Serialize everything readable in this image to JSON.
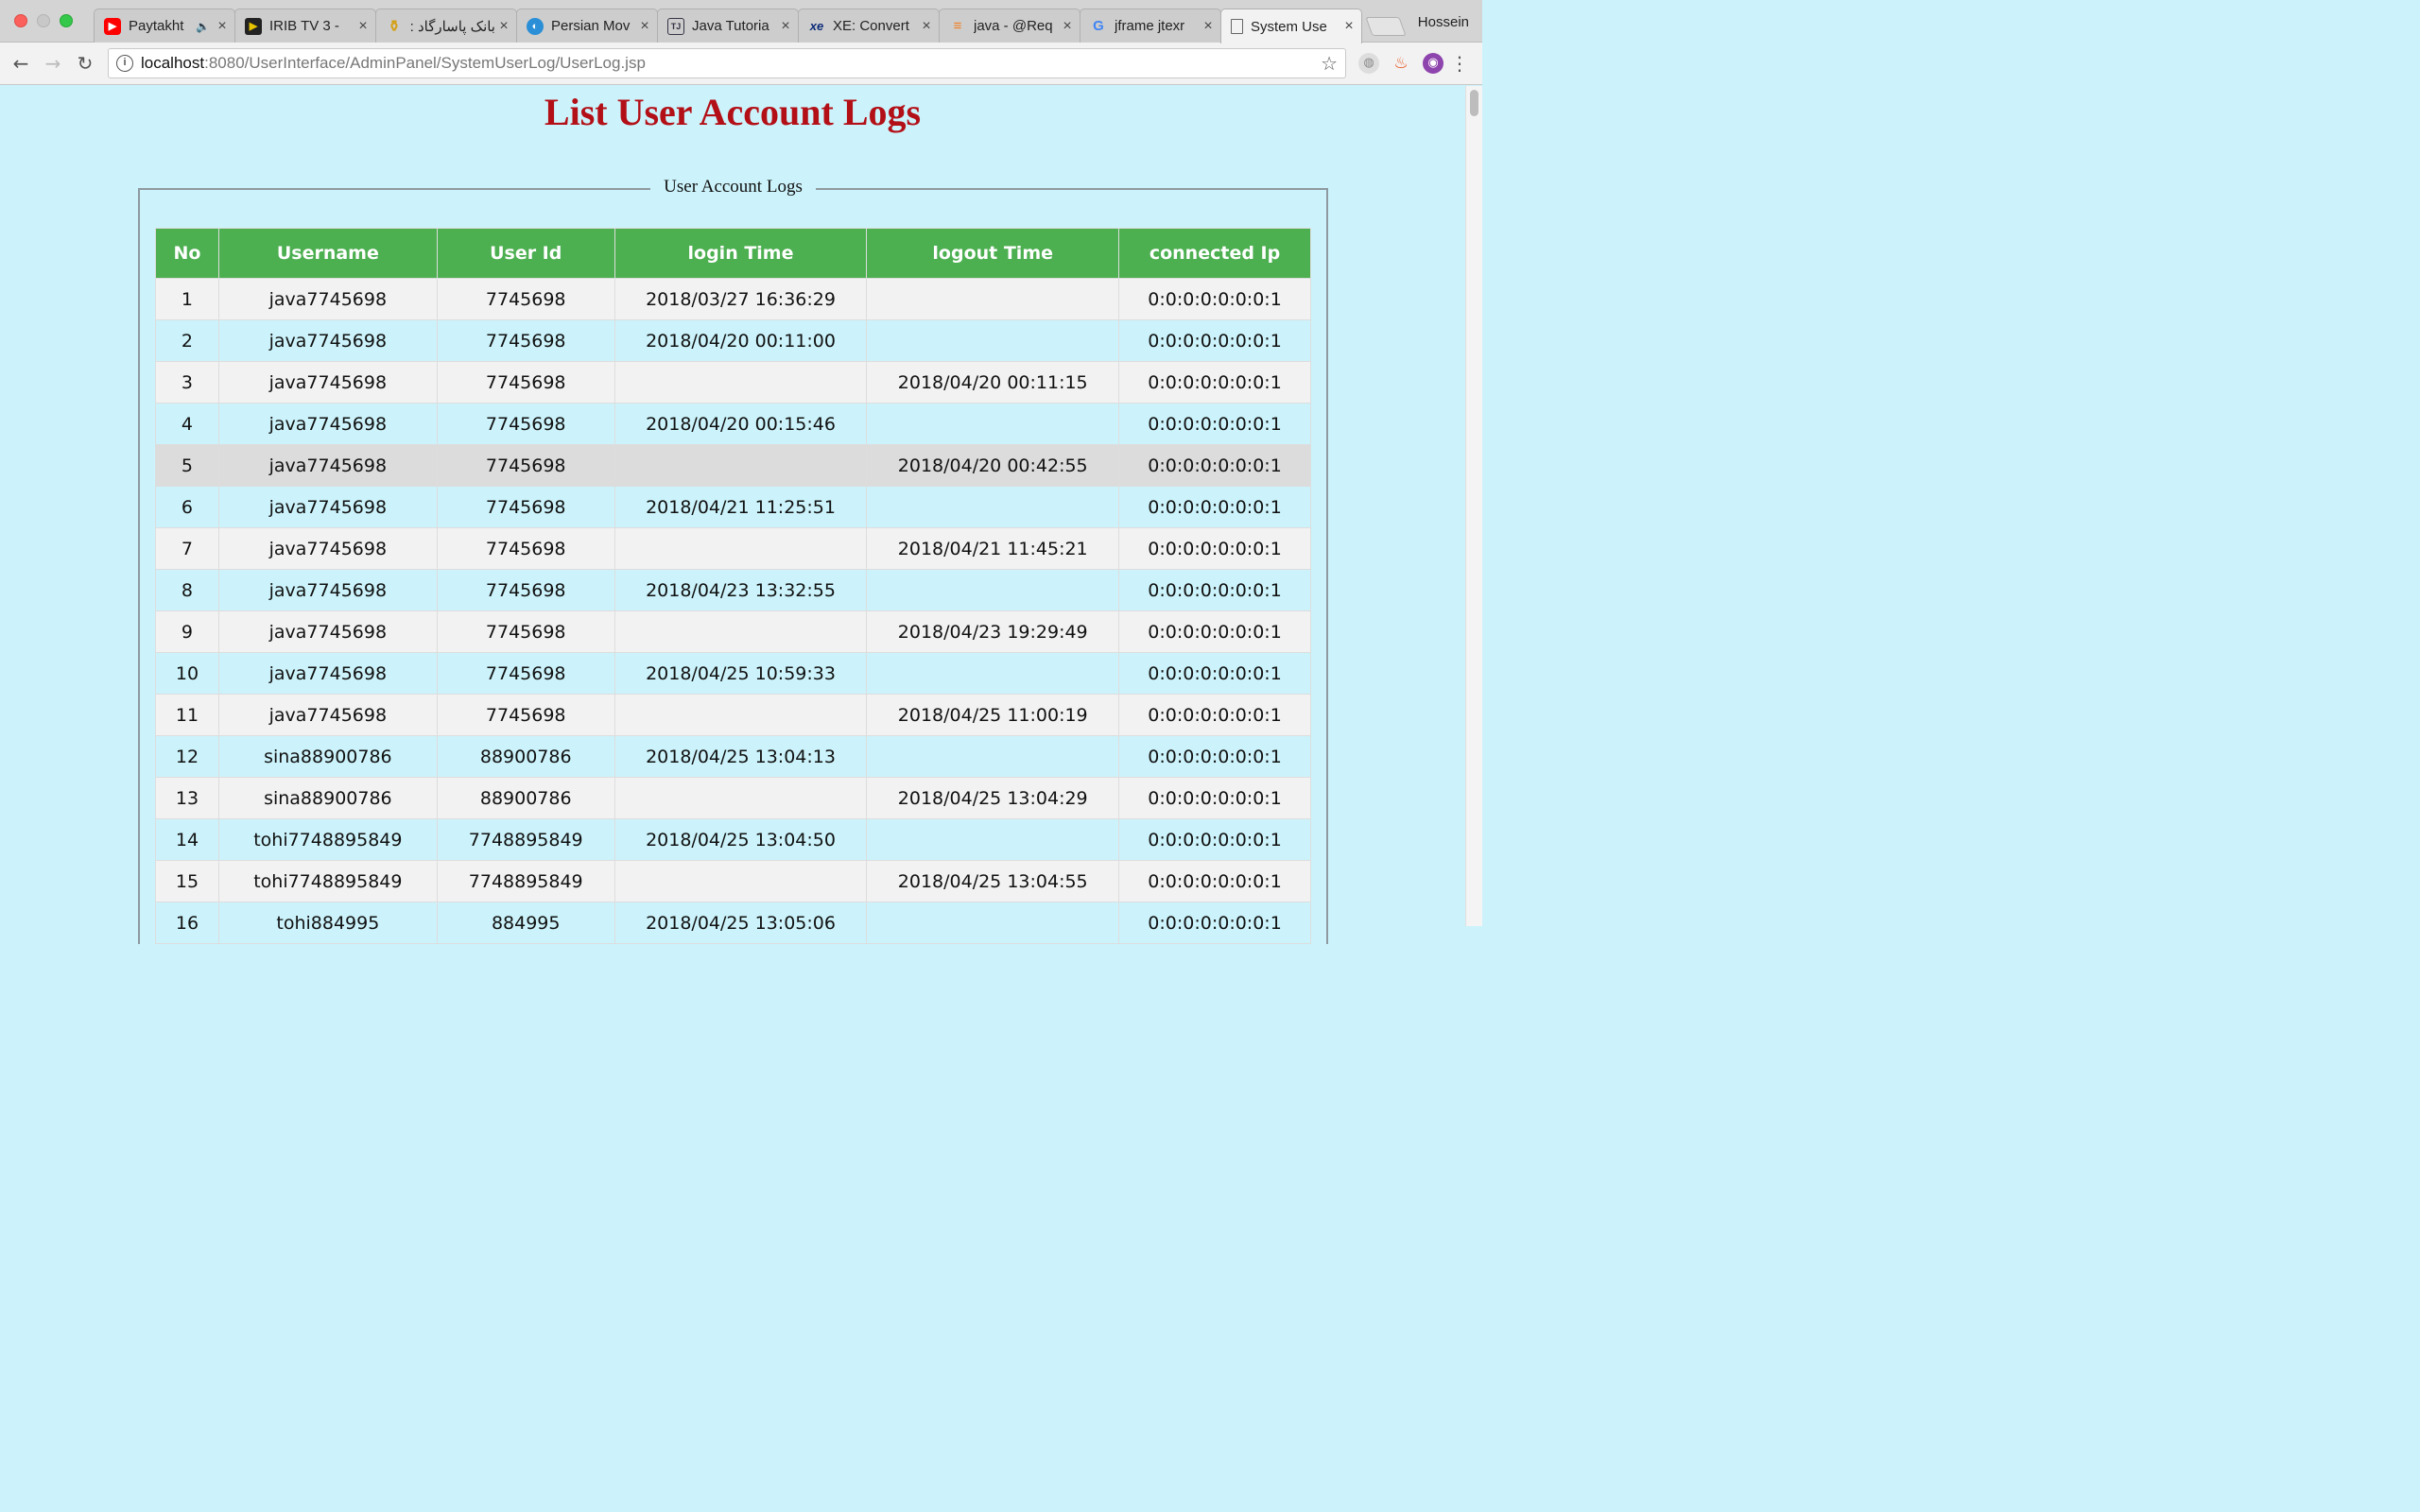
{
  "browser": {
    "tabs": [
      {
        "title": "Paytakht",
        "icon": "youtube-icon"
      },
      {
        "title": "IRIB TV 3 - ",
        "icon": "play-icon"
      },
      {
        "title": "بانک پاسارگاد ::",
        "icon": "bank-icon"
      },
      {
        "title": "Persian Mov",
        "icon": "globe-icon"
      },
      {
        "title": "Java Tutoria",
        "icon": "document-icon"
      },
      {
        "title": "XE: Convert",
        "icon": "xe-icon"
      },
      {
        "title": "java - @Req",
        "icon": "stackoverflow-icon"
      },
      {
        "title": "jframe jtexr",
        "icon": "google-icon"
      },
      {
        "title": "System Use",
        "icon": "page-icon"
      }
    ],
    "profile": "Hossein",
    "url_host": "localhost",
    "url_path": ":8080/UserInterface/AdminPanel/SystemUserLog/UserLog.jsp"
  },
  "page": {
    "title": "List User Account Logs",
    "legend": "User Account Logs",
    "columns": [
      "No",
      "Username",
      "User Id",
      "login Time",
      "logout Time",
      "connected Ip"
    ],
    "rows": [
      [
        "1",
        "java7745698",
        "7745698",
        "2018/03/27 16:36:29",
        "",
        "0:0:0:0:0:0:0:1"
      ],
      [
        "2",
        "java7745698",
        "7745698",
        "2018/04/20 00:11:00",
        "",
        "0:0:0:0:0:0:0:1"
      ],
      [
        "3",
        "java7745698",
        "7745698",
        "",
        "2018/04/20 00:11:15",
        "0:0:0:0:0:0:0:1"
      ],
      [
        "4",
        "java7745698",
        "7745698",
        "2018/04/20 00:15:46",
        "",
        "0:0:0:0:0:0:0:1"
      ],
      [
        "5",
        "java7745698",
        "7745698",
        "",
        "2018/04/20 00:42:55",
        "0:0:0:0:0:0:0:1"
      ],
      [
        "6",
        "java7745698",
        "7745698",
        "2018/04/21 11:25:51",
        "",
        "0:0:0:0:0:0:0:1"
      ],
      [
        "7",
        "java7745698",
        "7745698",
        "",
        "2018/04/21 11:45:21",
        "0:0:0:0:0:0:0:1"
      ],
      [
        "8",
        "java7745698",
        "7745698",
        "2018/04/23 13:32:55",
        "",
        "0:0:0:0:0:0:0:1"
      ],
      [
        "9",
        "java7745698",
        "7745698",
        "",
        "2018/04/23 19:29:49",
        "0:0:0:0:0:0:0:1"
      ],
      [
        "10",
        "java7745698",
        "7745698",
        "2018/04/25 10:59:33",
        "",
        "0:0:0:0:0:0:0:1"
      ],
      [
        "11",
        "java7745698",
        "7745698",
        "",
        "2018/04/25 11:00:19",
        "0:0:0:0:0:0:0:1"
      ],
      [
        "12",
        "sina88900786",
        "88900786",
        "2018/04/25 13:04:13",
        "",
        "0:0:0:0:0:0:0:1"
      ],
      [
        "13",
        "sina88900786",
        "88900786",
        "",
        "2018/04/25 13:04:29",
        "0:0:0:0:0:0:0:1"
      ],
      [
        "14",
        "tohi7748895849",
        "7748895849",
        "2018/04/25 13:04:50",
        "",
        "0:0:0:0:0:0:0:1"
      ],
      [
        "15",
        "tohi7748895849",
        "7748895849",
        "",
        "2018/04/25 13:04:55",
        "0:0:0:0:0:0:0:1"
      ],
      [
        "16",
        "tohi884995",
        "884995",
        "2018/04/25 13:05:06",
        "",
        "0:0:0:0:0:0:0:1"
      ]
    ],
    "hover_row": "5"
  },
  "colors": {
    "title": "#b30f17",
    "header_bg": "#4caf50",
    "page_bg": "#ccf3fb",
    "odd_row": "#f2f2f2",
    "hover_row": "#dcdcdc"
  }
}
